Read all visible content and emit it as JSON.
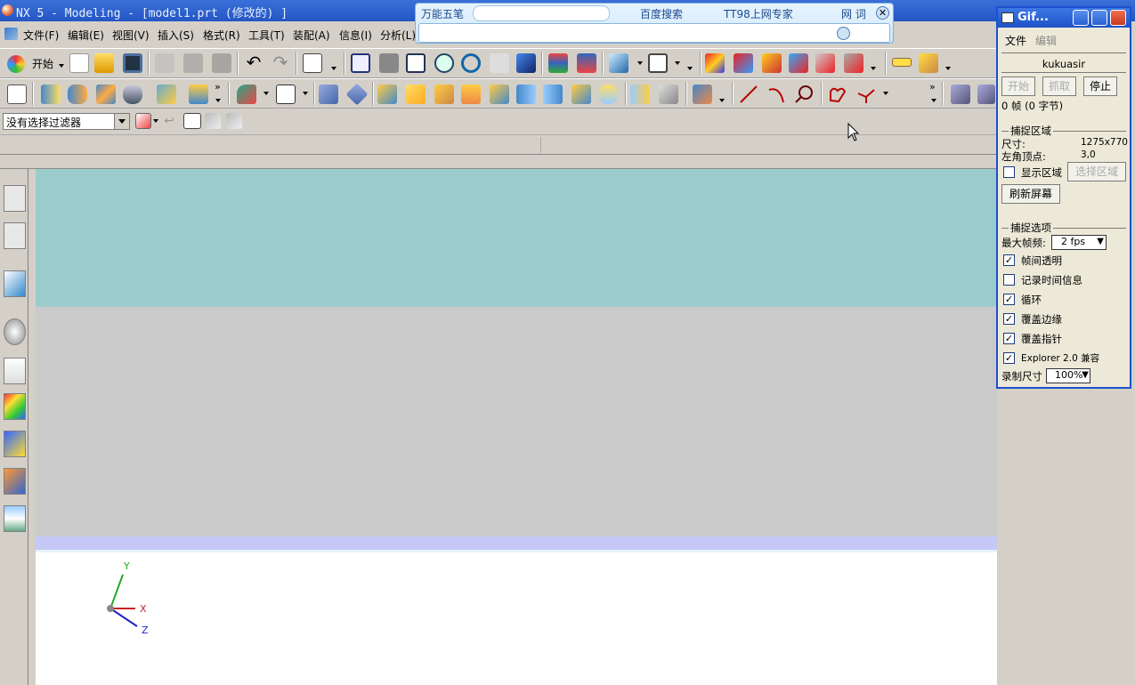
{
  "window": {
    "title": "NX 5 - Modeling - [model1.prt (修改的) ]"
  },
  "menu": {
    "items": [
      "文件(F)",
      "编辑(E)",
      "视图(V)",
      "插入(S)",
      "格式(R)",
      "工具(T)",
      "装配(A)",
      "信息(I)",
      "分析(L)"
    ]
  },
  "toolbar": {
    "start_label": "开始",
    "filter_value": "没有选择过滤器"
  },
  "ime": {
    "tabs": [
      "万能五笔",
      "百度搜索",
      "TT98上网专家",
      "网 词"
    ]
  },
  "gif_recorder": {
    "title": "Gif...",
    "menu": [
      "文件",
      "编辑"
    ],
    "user": "kukuasir",
    "buttons": {
      "start": "开始",
      "grab": "抓取",
      "stop": "停止"
    },
    "status": "0 帧 (0 字节)",
    "capture_area": {
      "heading": "捕捉区域",
      "size_label": "尺寸:",
      "size_value": "1275x770",
      "origin_label": "左角顶点:",
      "origin_value": "3,0",
      "show_area_label": "显示区域",
      "select_area_button": "选择区域",
      "refresh_button": "刷新屏幕"
    },
    "capture_options": {
      "heading": "捕捉选项",
      "fps_label": "最大帧频:",
      "fps_value": "2 fps",
      "options": [
        {
          "label": "帧间透明",
          "checked": true
        },
        {
          "label": "记录时间信息",
          "checked": false
        },
        {
          "label": "循环",
          "checked": true
        },
        {
          "label": "覆盖边缘",
          "checked": true
        },
        {
          "label": "覆盖指针",
          "checked": true
        },
        {
          "label": "Explorer 2.0 兼容",
          "checked": true
        }
      ],
      "record_size_label": "录制尺寸",
      "record_size_value": "100%"
    }
  },
  "axes": {
    "x": "X",
    "y": "Y",
    "z": "Z"
  },
  "colors": {
    "title_blue": "#2456c4",
    "viewport_teal": "#9bcbcb",
    "viewport_gray": "#cacaca",
    "viewport_lavender": "#c6c8f6"
  }
}
